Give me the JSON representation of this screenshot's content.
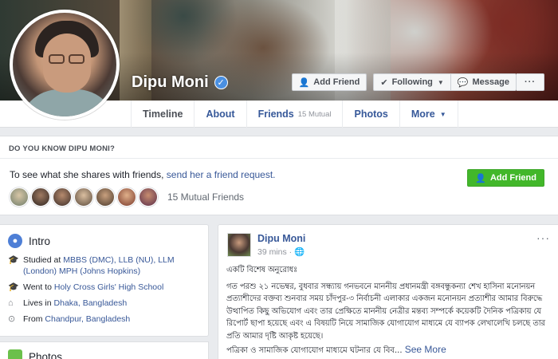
{
  "profile": {
    "name": "Dipu Moni",
    "verified_glyph": "✓"
  },
  "cover_buttons": {
    "add_friend": "Add Friend",
    "following": "Following",
    "message": "Message",
    "more_dots": "···"
  },
  "tabs": [
    {
      "label": "Timeline",
      "sub": ""
    },
    {
      "label": "About",
      "sub": ""
    },
    {
      "label": "Friends",
      "sub": "15 Mutual"
    },
    {
      "label": "Photos",
      "sub": ""
    },
    {
      "label": "More",
      "sub": ""
    }
  ],
  "know_box": {
    "heading": "DO YOU KNOW DIPU MONI?",
    "text_prefix": "To see what she shares with friends, ",
    "link": "send her a friend request.",
    "add_friend": "Add Friend",
    "mutual_count": "15 Mutual Friends",
    "mutual_colors": [
      "#a9b6a0",
      "#5c4a3d",
      "#7a5a44",
      "#c0a58a",
      "#8e6e56",
      "#b07f5c",
      "#6a3d4a"
    ]
  },
  "intro": {
    "title": "Intro",
    "studied_prefix": "Studied at ",
    "studied_link": "MBBS (DMC), LLB (NU), LLM (London) MPH (Johns Hopkins)",
    "went_prefix": "Went to ",
    "went_link": "Holy Cross Girls' High School",
    "lives_prefix": "Lives in ",
    "lives_link": "Dhaka, Bangladesh",
    "from_prefix": "From ",
    "from_link": "Chandpur, Bangladesh"
  },
  "photos_section": {
    "title": "Photos"
  },
  "post": {
    "author": "Dipu Moni",
    "time": "39 mins · 🌐",
    "dots": "···",
    "line1": "একটি বিশেষ অনুরোধঃ",
    "para": "গত পরশু ২১ নভেম্বর, বুধবার সন্ধ্যায় গনভবনে মাননীয় প্রধানমন্ত্রী বঙ্গবন্ধুকন্যা শেখ হাসিনা মনোনয়ন প্রত্যাশীদের বক্তব্য শুনবার সময় চাঁদপুর-৩ নির্বাচনী এলাকার একজন মনোনয়ন প্রত্যাশীর আমার বিরুদ্ধে উত্থাপিত কিছু অভিযোগ এবং তার প্রেক্ষিতে মাননীয় নেত্রীর মন্তব্য সম্পর্কে কয়েকটি দৈনিক পত্রিকায় যে রিপোর্ট ছাপা হয়েছে এবং এ বিষয়টি নিয়ে সামাজিক যোগাযোগ মাধ্যমে যে ব্যাপক লেখালেখি চলছে তার প্রতি আমার দৃষ্টি আকৃষ্ট হয়েছে।",
    "last_line": "পত্রিকা ও সামাজিক যোগাযোগ মাধ্যমে ঘটনার যে বিব... ",
    "see_more": "See More"
  }
}
